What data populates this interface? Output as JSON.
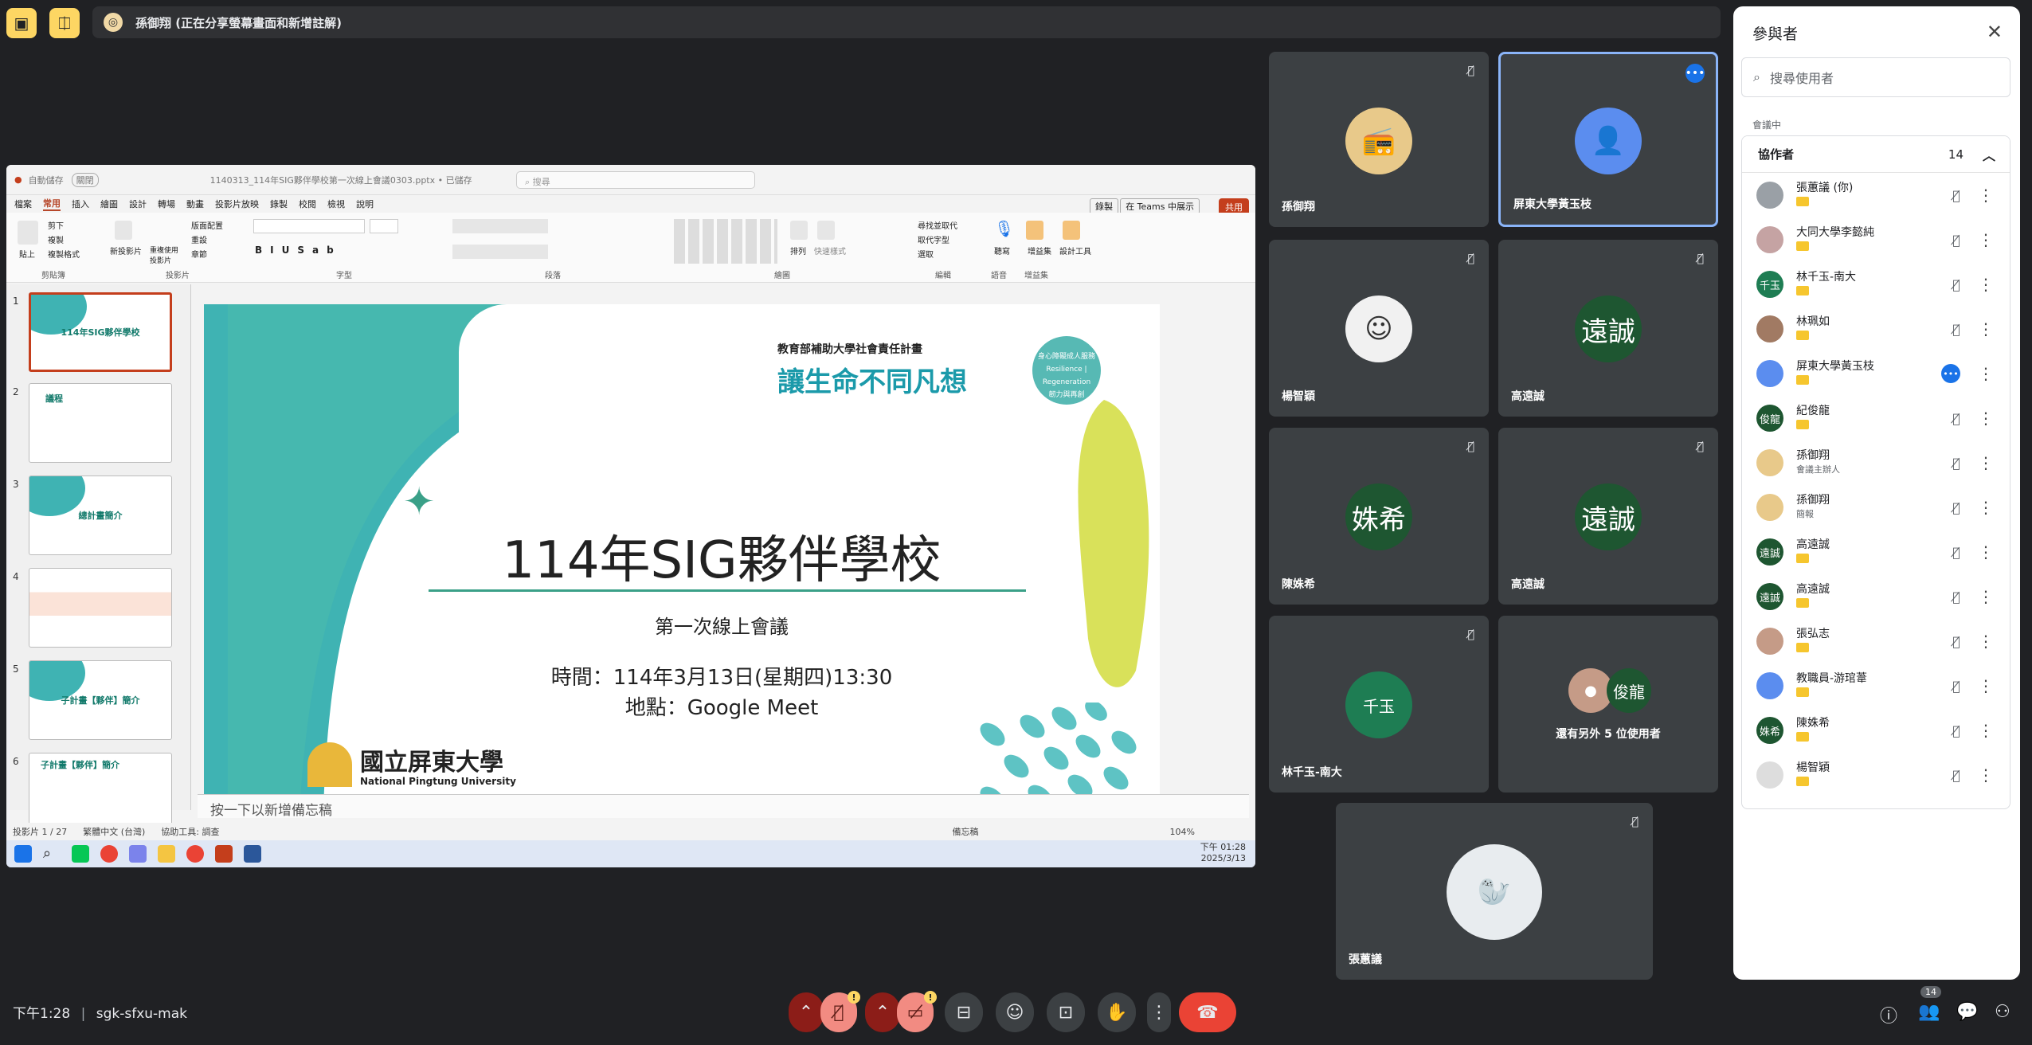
{
  "presenter_bar": {
    "text": "孫御翔 (正在分享螢幕畫面和新增註解)"
  },
  "powerpoint": {
    "autosave": "自動儲存",
    "autosave_state": "關閉",
    "filename": "1140313_114年SIG夥伴學校第一次線上會議0303.pptx • 已儲存",
    "search": "搜尋",
    "tabs": [
      "檔案",
      "常用",
      "插入",
      "繪圖",
      "設計",
      "轉場",
      "動畫",
      "投影片放映",
      "錄製",
      "校閱",
      "檢視",
      "說明"
    ],
    "active_tab": "常用",
    "record_btn": "錄製",
    "teams_btn": "在 Teams 中展示",
    "share_btn": "共用",
    "ribbon_groups": [
      "剪貼簿",
      "投影片",
      "字型",
      "段落",
      "繪圖",
      "編輯",
      "語音",
      "增益集"
    ],
    "ribbon_labels": {
      "paste": "貼上",
      "cut": "剪下",
      "copy": "複製",
      "format_painter": "複製格式",
      "new_slide": "新投影片",
      "reuse": "重複使用投影片",
      "layout": "版面配置",
      "reset": "重設",
      "section": "章節",
      "arrange": "排列",
      "quick_styles": "快速樣式",
      "find": "尋找並取代",
      "replace": "取代字型",
      "select": "選取",
      "dictate": "聽寫",
      "addins": "增益集",
      "designer": "設計工具"
    },
    "thumbnails": [
      {
        "num": "1",
        "title": "114年SIG夥伴學校"
      },
      {
        "num": "2",
        "title": "議程"
      },
      {
        "num": "3",
        "title": "總計畫簡介"
      },
      {
        "num": "4",
        "title": ""
      },
      {
        "num": "5",
        "title": "子計畫【夥伴】簡介"
      },
      {
        "num": "6",
        "title": "子計畫【夥伴】簡介"
      }
    ],
    "slide": {
      "banner_line1": "教育部補助大學社會責任計畫",
      "banner_line2": "讓生命不同凡想",
      "badge_line1": "身心障礙成人服務",
      "badge_line2": "Resilience | Regeneration",
      "badge_line3": "韌力與再創",
      "title": "114年SIG夥伴學校",
      "subtitle": "第一次線上會議",
      "time": "時間：114年3月13日(星期四)13:30",
      "place": "地點：Google Meet",
      "univ_zh": "國立屏東大學",
      "univ_en": "National Pingtung University"
    },
    "notes_placeholder": "按一下以新增備忘稿",
    "status": {
      "slide": "投影片 1 / 27",
      "lang": "繁體中文 (台灣)",
      "access": "協助工具: 調查",
      "notes": "備忘稿",
      "zoom": "104%"
    },
    "clock": {
      "time": "下午 01:28",
      "date": "2025/3/13"
    }
  },
  "tiles": [
    {
      "name": "孫御翔",
      "initials": ""
    },
    {
      "name": "屏東大學黃玉枝",
      "initials": ""
    },
    {
      "name": "楊智穎",
      "initials": ""
    },
    {
      "name": "高遠誠",
      "initials": "遠誠"
    },
    {
      "name": "陳姝希",
      "initials": "姝希"
    },
    {
      "name": "高遠誠",
      "initials": "遠誠"
    },
    {
      "name": "林千玉-南大",
      "initials": ""
    },
    {
      "name": "還有另外 5 位使用者",
      "initials": "俊龍"
    },
    {
      "name": "張蕙議",
      "initials": ""
    }
  ],
  "panel": {
    "title": "參與者",
    "search_placeholder": "搜尋使用者",
    "section": "會議中",
    "group": "協作者",
    "group_count": "14",
    "people": [
      {
        "name": "張蕙議 (你)",
        "sub": "",
        "color": "#9aa0a6",
        "initials": ""
      },
      {
        "name": "大同大學李懿純",
        "sub": "",
        "color": "#c5a3a3",
        "initials": ""
      },
      {
        "name": "林千玉-南大",
        "sub": "",
        "color": "#1e7d53",
        "initials": "千玉"
      },
      {
        "name": "林珮如",
        "sub": "",
        "color": "#a17a63",
        "initials": ""
      },
      {
        "name": "屏東大學黃玉枝",
        "sub": "",
        "color": "#5b8def",
        "initials": ""
      },
      {
        "name": "紀俊龍",
        "sub": "",
        "color": "#1e5631",
        "initials": "俊龍"
      },
      {
        "name": "孫御翔",
        "sub": "會議主辦人",
        "color": "#e8c98a",
        "initials": ""
      },
      {
        "name": "孫御翔",
        "sub": "簡報",
        "color": "#e8c98a",
        "initials": ""
      },
      {
        "name": "高遠誠",
        "sub": "",
        "color": "#1e5631",
        "initials": "遠誠"
      },
      {
        "name": "高遠誠",
        "sub": "",
        "color": "#1e5631",
        "initials": "遠誠"
      },
      {
        "name": "張弘志",
        "sub": "",
        "color": "#c59b87",
        "initials": ""
      },
      {
        "name": "教職員-游琯葦",
        "sub": "",
        "color": "#5b8def",
        "initials": ""
      },
      {
        "name": "陳姝希",
        "sub": "",
        "color": "#1e5631",
        "initials": "姝希"
      },
      {
        "name": "楊智穎",
        "sub": "",
        "color": "#dddddd",
        "initials": ""
      }
    ]
  },
  "bottom": {
    "time": "下午1:28",
    "code": "sgk-sfxu-mak",
    "participants_count": "14"
  },
  "colors": {
    "background": "#202124",
    "tile": "#3c4043",
    "end_call": "#ea4335",
    "accent_yellow": "#fdd663",
    "slide_teal": "#3fb3b3"
  }
}
